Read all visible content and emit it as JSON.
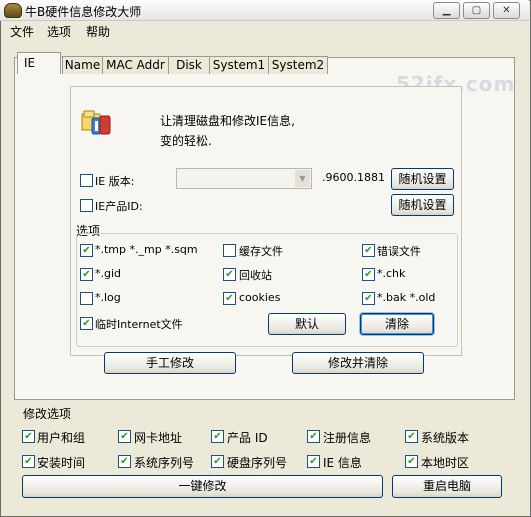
{
  "window": {
    "title": "牛B硬件信息修改大师",
    "controls": [
      "▁",
      "▢",
      "✕"
    ]
  },
  "menu": [
    "文件",
    "选项",
    "帮助"
  ],
  "tabs": [
    "IE",
    "Name",
    "MAC Addr",
    "Disk",
    "System1",
    "System2"
  ],
  "watermark": "52ifx.com",
  "ie_panel": {
    "description_line1": "让清理磁盘和修改IE信息,",
    "description_line2": "变的轻松.",
    "ie_version_label": "IE 版本:",
    "ie_version_value": ".9600.1881",
    "ie_product_label": "IE产品ID:",
    "random_button": "随机设置",
    "random_button2": "随机设置",
    "options_label": "选项",
    "options": [
      {
        "label": "*.tmp  *._mp  *.sqm",
        "checked": true
      },
      {
        "label": "缓存文件",
        "checked": false
      },
      {
        "label": "错误文件",
        "checked": true
      },
      {
        "label": "*.gid",
        "checked": true
      },
      {
        "label": "回收站",
        "checked": true
      },
      {
        "label": "*.chk",
        "checked": true
      },
      {
        "label": "*.log",
        "checked": false
      },
      {
        "label": "cookies",
        "checked": true
      },
      {
        "label": "*.bak  *.old",
        "checked": true
      },
      {
        "label": "临时Internet文件",
        "checked": true
      }
    ],
    "default_button": "默认",
    "clear_button": "清除",
    "manual_button": "手工修改",
    "modify_clear_button": "修改并清除"
  },
  "modify_options": {
    "label": "修改选项",
    "items": [
      {
        "label": "用户和组",
        "checked": true
      },
      {
        "label": "网卡地址",
        "checked": true
      },
      {
        "label": "产品 ID",
        "checked": true
      },
      {
        "label": "注册信息",
        "checked": true
      },
      {
        "label": "系统版本",
        "checked": true
      },
      {
        "label": "安装时间",
        "checked": true
      },
      {
        "label": "系统序列号",
        "checked": true
      },
      {
        "label": "硬盘序列号",
        "checked": true
      },
      {
        "label": "IE 信息",
        "checked": true
      },
      {
        "label": "本地时区",
        "checked": true
      }
    ],
    "one_click_button": "一键修改",
    "restart_button": "重启电脑"
  },
  "check_mark": "✔"
}
